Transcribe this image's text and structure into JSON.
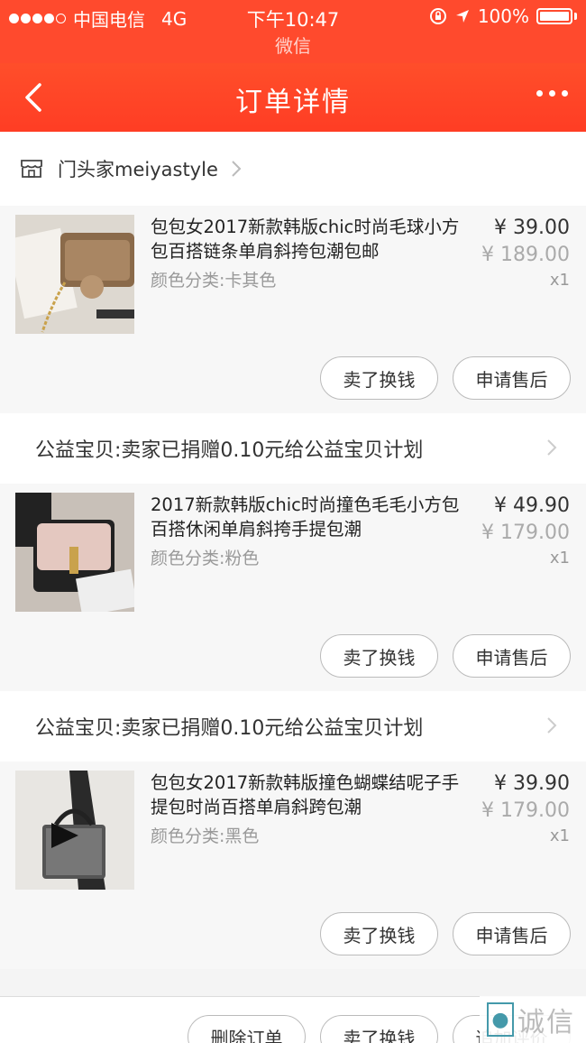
{
  "status_bar": {
    "carrier": "中国电信",
    "network": "4G",
    "time": "下午10:47",
    "battery": "100%"
  },
  "subtitle": "微信",
  "nav": {
    "title": "订单详情"
  },
  "shop": {
    "name": "门头家meiyastyle"
  },
  "items": [
    {
      "name": "包包女2017新款韩版chic时尚毛球小方包百搭链条单肩斜挎包潮包邮",
      "spec": "颜色分类:卡其色",
      "price": "¥ 39.00",
      "original_price": "¥ 189.00",
      "qty": "x1",
      "btn_sell": "卖了换钱",
      "btn_aftersale": "申请售后",
      "charity": "公益宝贝:卖家已捐赠0.10元给公益宝贝计划"
    },
    {
      "name": "2017新款韩版chic时尚撞色毛毛小方包百搭休闲单肩斜挎手提包潮",
      "spec": "颜色分类:粉色",
      "price": "¥ 49.90",
      "original_price": "¥ 179.00",
      "qty": "x1",
      "btn_sell": "卖了换钱",
      "btn_aftersale": "申请售后",
      "charity": "公益宝贝:卖家已捐赠0.10元给公益宝贝计划"
    },
    {
      "name": "包包女2017新款韩版撞色蝴蝶结呢子手提包时尚百搭单肩斜跨包潮",
      "spec": "颜色分类:黑色",
      "price": "¥ 39.90",
      "original_price": "¥ 179.00",
      "qty": "x1",
      "btn_sell": "卖了换钱",
      "btn_aftersale": "申请售后"
    }
  ],
  "bottom_bar": {
    "delete": "删除订单",
    "sell": "卖了换钱",
    "review": "追加评价"
  },
  "watermark": {
    "text": "诚信"
  },
  "colors": {
    "accent": "#ff4a2d"
  }
}
